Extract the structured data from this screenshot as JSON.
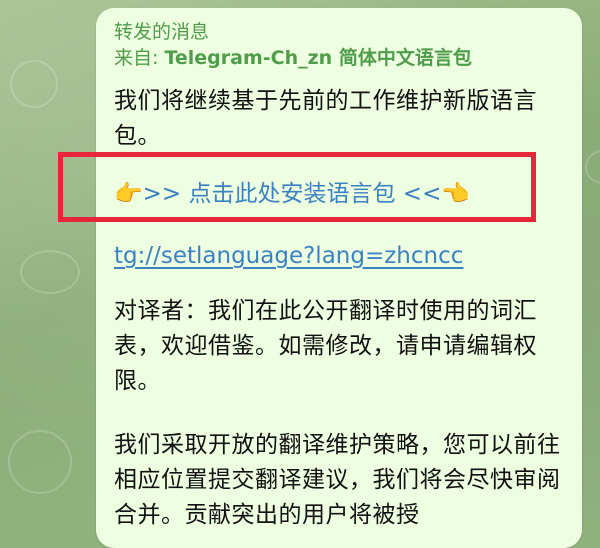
{
  "message": {
    "forward_label": "转发的消息",
    "forward_from_prefix": "来自: ",
    "forward_from_source": "Telegram-Ch_zn 简体中文语言包",
    "paragraph1": "我们将继续基于先前的工作维护新版语言包。",
    "install_link": "👉>> 点击此处安装语言包 <<👈",
    "tg_link": "tg://setlanguage?lang=zhcncc",
    "paragraph2": "对译者：我们在此公开翻译时使用的词汇表，欢迎借鉴。如需修改，请申请编辑权限。",
    "paragraph3": "我们采取开放的翻译维护策略，您可以前往相应位置提交翻译建议，我们将会尽快审阅合并。贡献突出的用户将被授"
  },
  "colors": {
    "bubble_bg": "#eefee1",
    "forward_green": "#4f9d4a",
    "link_blue": "#3a82c4",
    "highlight_red": "#e8263a"
  }
}
